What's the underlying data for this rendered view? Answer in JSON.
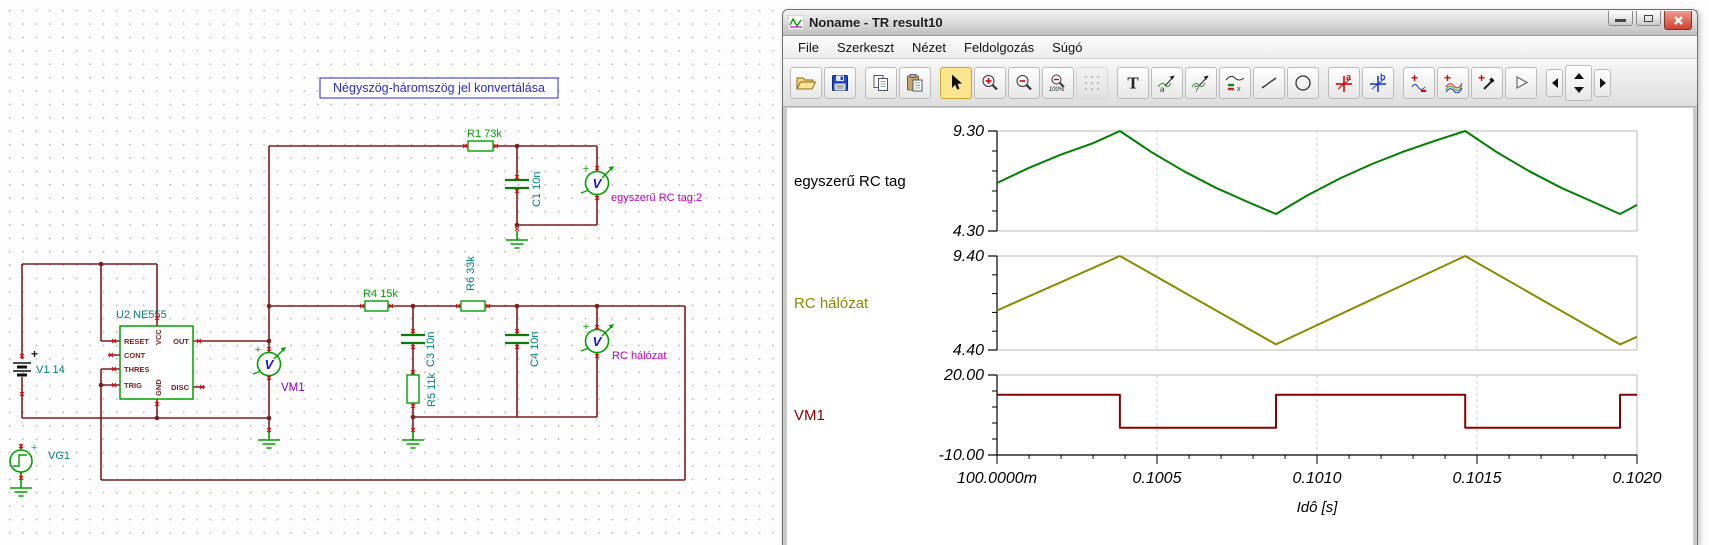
{
  "schematic": {
    "caption": "Négyszög-háromszög jel konvertálása",
    "labels": {
      "r1": "R1 73k",
      "c1": "C1 10n",
      "meter_rc_tag": "egyszerű RC tag:2",
      "u2": "U2 NE555",
      "v1": "V1 14",
      "vg1": "VG1",
      "r4": "R4 15k",
      "r6": "R6 33k",
      "c3": "C3 10n",
      "r5": "R5 11k",
      "c4": "C4 10n",
      "vm1": "VM1",
      "meter_rc_network": "RC hálózat",
      "pin_reset": "RESET",
      "pin_cont": "CONT",
      "pin_thres": "THRES",
      "pin_trig": "TRIG",
      "pin_vcc": "VCC",
      "pin_gnd": "GND",
      "pin_out": "OUT",
      "pin_disc": "DISC",
      "meter_letter": "V",
      "plus": "+"
    },
    "colors": {
      "wire": "#7a1e1e",
      "component_green": "#00a000",
      "capacitor_green": "#0a7a0a",
      "label_teal": "#007e7e",
      "label_green": "#00a000",
      "label_magenta": "#c000c0",
      "label_purple": "#8a00c2",
      "title_blue": "#2a2ac8",
      "terminal_red": "#e80000",
      "meter_v_blue": "#1414c8"
    }
  },
  "window": {
    "title": "Noname - TR result10",
    "menu_items": [
      "File",
      "Szerkeszt",
      "Nézet",
      "Feldolgozás",
      "Súgó"
    ],
    "toolbar_groups": [
      [
        "open",
        "save"
      ],
      [
        "copy",
        "paste"
      ],
      [
        "cursor",
        "zoom-in",
        "zoom-out",
        "zoom-100",
        "grid"
      ],
      [
        "text",
        "autoscale-a",
        "autoscale-q",
        "legend",
        "line",
        "ellipse"
      ],
      [
        "cursor-a",
        "cursor-b"
      ],
      [
        "add-remove-curve",
        "add-curves",
        "probe",
        "marker"
      ],
      [
        "nav-prev",
        "nav-scroll",
        "nav-next"
      ]
    ],
    "selected_tool": "cursor"
  },
  "chart_data": [
    {
      "type": "line",
      "name": "egyszerű RC tag",
      "color": "#008000",
      "label_color": "#000000",
      "ylim": [
        4.3,
        9.3
      ],
      "yticklabels": [
        "9.30",
        "4.30"
      ],
      "x": [
        0.1,
        0.1001,
        0.1002,
        0.1003,
        0.100384,
        0.100484,
        0.100584,
        0.100684,
        0.100784,
        0.100872,
        0.100972,
        0.101072,
        0.101172,
        0.101272,
        0.101372,
        0.101463,
        0.101563,
        0.101663,
        0.101763,
        0.101863,
        0.101947,
        0.102
      ],
      "y": [
        6.7,
        7.46,
        8.12,
        8.69,
        9.3,
        8.23,
        7.29,
        6.46,
        5.75,
        5.15,
        6.1,
        6.93,
        7.65,
        8.28,
        8.83,
        9.3,
        8.23,
        7.29,
        6.46,
        5.75,
        5.15,
        5.6
      ]
    },
    {
      "type": "line",
      "name": "RC hálózat",
      "color": "#8a8a00",
      "label_color": "#8a8a00",
      "ylim": [
        4.4,
        9.4
      ],
      "yticklabels": [
        "9.40",
        "4.40"
      ],
      "x": [
        0.1,
        0.100192,
        0.100384,
        0.100628,
        0.100872,
        0.101167,
        0.101463,
        0.101705,
        0.101947,
        0.102
      ],
      "y": [
        6.5,
        7.95,
        9.4,
        7.05,
        4.7,
        7.05,
        9.4,
        7.05,
        4.7,
        5.1
      ]
    },
    {
      "type": "line",
      "name": "VM1",
      "color": "#8b0000",
      "label_color": "#8b0000",
      "ylim": [
        -10.0,
        20.0
      ],
      "yticklabels": [
        "20.00",
        "-10.00"
      ],
      "x": [
        0.1,
        0.100384,
        0.100384,
        0.100872,
        0.100872,
        0.101463,
        0.101463,
        0.101947,
        0.101947,
        0.102
      ],
      "y": [
        12.6,
        12.6,
        0.2,
        0.2,
        12.6,
        12.6,
        0.2,
        0.2,
        12.6,
        12.6
      ]
    }
  ],
  "xaxis": {
    "label": "Idô [s]",
    "xlim": [
      0.1,
      0.102
    ],
    "ticks": [
      0.1,
      0.1005,
      0.101,
      0.1015,
      0.102
    ],
    "ticklabels": [
      "100.0000m",
      "0.1005",
      "0.1010",
      "0.1015",
      "0.1020"
    ],
    "minor_step": 0.0001
  }
}
